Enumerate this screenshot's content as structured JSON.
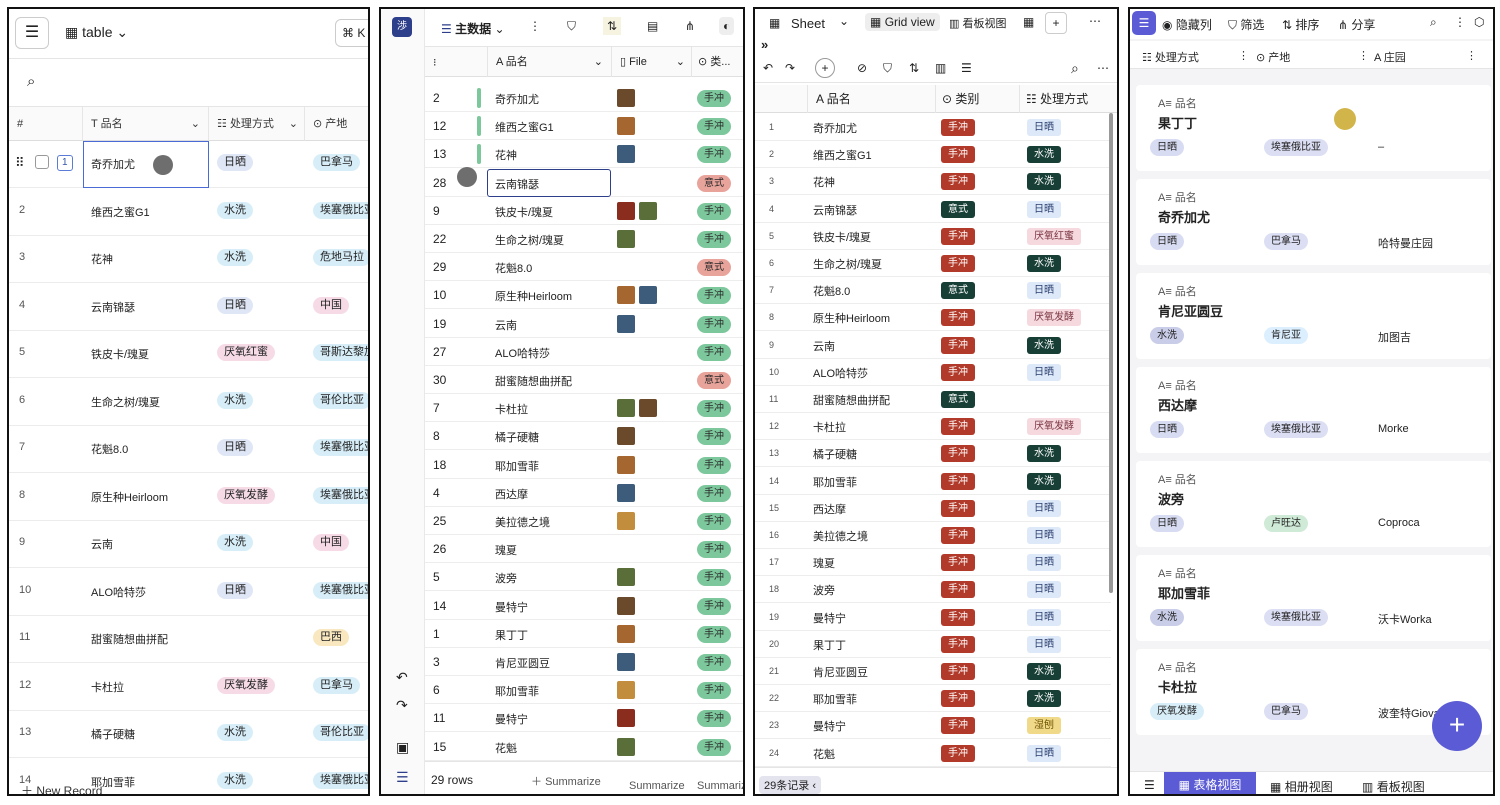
{
  "panel1": {
    "view_name": "table",
    "shortcut": "⌘ K",
    "columns": [
      "#",
      "品名",
      "处理方式",
      "产地"
    ],
    "selected_index": "1",
    "new_record": "New Record",
    "rows": [
      {
        "n": "",
        "name": "奇乔加尤",
        "proc": "日晒",
        "origin": "巴拿马"
      },
      {
        "n": "2",
        "name": "维西之蜜G1",
        "proc": "水洗",
        "origin": "埃塞俄比亚"
      },
      {
        "n": "3",
        "name": "花神",
        "proc": "水洗",
        "origin": "危地马拉"
      },
      {
        "n": "4",
        "name": "云南锦瑟",
        "proc": "日晒",
        "origin": "中国"
      },
      {
        "n": "5",
        "name": "铁皮卡/瑰夏",
        "proc": "厌氧红蜜",
        "origin": "哥斯达黎加"
      },
      {
        "n": "6",
        "name": "生命之树/瑰夏",
        "proc": "水洗",
        "origin": "哥伦比亚"
      },
      {
        "n": "7",
        "name": "花魁8.0",
        "proc": "日晒",
        "origin": "埃塞俄比亚"
      },
      {
        "n": "8",
        "name": "原生种Heirloom",
        "proc": "厌氧发酵",
        "origin": "埃塞俄比亚"
      },
      {
        "n": "9",
        "name": "云南",
        "proc": "水洗",
        "origin": "中国"
      },
      {
        "n": "10",
        "name": "ALO哈特莎",
        "proc": "日晒",
        "origin": "埃塞俄比亚"
      },
      {
        "n": "11",
        "name": "甜蜜随想曲拼配",
        "proc": "",
        "origin": "巴西"
      },
      {
        "n": "12",
        "name": "卡杜拉",
        "proc": "厌氧发酵",
        "origin": "巴拿马"
      },
      {
        "n": "13",
        "name": "橘子硬糖",
        "proc": "水洗",
        "origin": "哥伦比亚"
      },
      {
        "n": "14",
        "name": "耶加雪菲",
        "proc": "水洗",
        "origin": "埃塞俄比亚"
      }
    ]
  },
  "panel2": {
    "logo": "渉",
    "view_name": "主数据",
    "columns": [
      "品名",
      "File",
      "类..."
    ],
    "rows_count": "29 rows",
    "summarize": "Summarize",
    "rows": [
      {
        "n": "2",
        "name": "奇乔加尤",
        "type": "手冲",
        "files": 1
      },
      {
        "n": "12",
        "name": "维西之蜜G1",
        "type": "手冲",
        "files": 1
      },
      {
        "n": "13",
        "name": "花神",
        "type": "手冲",
        "files": 1
      },
      {
        "n": "28",
        "name": "云南锦瑟",
        "type": "意式",
        "files": 0
      },
      {
        "n": "9",
        "name": "铁皮卡/瑰夏",
        "type": "手冲",
        "files": 2
      },
      {
        "n": "22",
        "name": "生命之树/瑰夏",
        "type": "手冲",
        "files": 1
      },
      {
        "n": "29",
        "name": "花魁8.0",
        "type": "意式",
        "files": 0
      },
      {
        "n": "10",
        "name": "原生种Heirloom",
        "type": "手冲",
        "files": 2
      },
      {
        "n": "19",
        "name": "云南",
        "type": "手冲",
        "files": 1
      },
      {
        "n": "27",
        "name": "ALO哈特莎",
        "type": "手冲",
        "files": 0
      },
      {
        "n": "30",
        "name": "甜蜜随想曲拼配",
        "type": "意式",
        "files": 0
      },
      {
        "n": "7",
        "name": "卡杜拉",
        "type": "手冲",
        "files": 2
      },
      {
        "n": "8",
        "name": "橘子硬糖",
        "type": "手冲",
        "files": 1
      },
      {
        "n": "18",
        "name": "耶加雪菲",
        "type": "手冲",
        "files": 1
      },
      {
        "n": "4",
        "name": "西达摩",
        "type": "手冲",
        "files": 1
      },
      {
        "n": "25",
        "name": "美拉德之境",
        "type": "手冲",
        "files": 1
      },
      {
        "n": "26",
        "name": "瑰夏",
        "type": "手冲",
        "files": 0
      },
      {
        "n": "5",
        "name": "波旁",
        "type": "手冲",
        "files": 1
      },
      {
        "n": "14",
        "name": "曼特宁",
        "type": "手冲",
        "files": 1
      },
      {
        "n": "1",
        "name": "果丁丁",
        "type": "手冲",
        "files": 1
      },
      {
        "n": "3",
        "name": "肯尼亚圆豆",
        "type": "手冲",
        "files": 1
      },
      {
        "n": "6",
        "name": "耶加雪菲",
        "type": "手冲",
        "files": 1
      },
      {
        "n": "11",
        "name": "曼特宁",
        "type": "手冲",
        "files": 1
      },
      {
        "n": "15",
        "name": "花魁",
        "type": "手冲",
        "files": 1
      }
    ]
  },
  "panel3": {
    "sheet": "Sheet",
    "grid_view": "Grid view",
    "kanban": "看板视图",
    "columns": [
      "品名",
      "类别",
      "处理方式"
    ],
    "record_count": "29条记录",
    "rows": [
      {
        "n": "1",
        "name": "奇乔加尤",
        "type": "手冲",
        "proc": "日晒"
      },
      {
        "n": "2",
        "name": "维西之蜜G1",
        "type": "手冲",
        "proc": "水洗"
      },
      {
        "n": "3",
        "name": "花神",
        "type": "手冲",
        "proc": "水洗"
      },
      {
        "n": "4",
        "name": "云南锦瑟",
        "type": "意式",
        "proc": "日晒"
      },
      {
        "n": "5",
        "name": "铁皮卡/瑰夏",
        "type": "手冲",
        "proc": "厌氧红蜜"
      },
      {
        "n": "6",
        "name": "生命之树/瑰夏",
        "type": "手冲",
        "proc": "水洗"
      },
      {
        "n": "7",
        "name": "花魁8.0",
        "type": "意式",
        "proc": "日晒"
      },
      {
        "n": "8",
        "name": "原生种Heirloom",
        "type": "手冲",
        "proc": "厌氧发酵"
      },
      {
        "n": "9",
        "name": "云南",
        "type": "手冲",
        "proc": "水洗"
      },
      {
        "n": "10",
        "name": "ALO哈特莎",
        "type": "手冲",
        "proc": "日晒"
      },
      {
        "n": "11",
        "name": "甜蜜随想曲拼配",
        "type": "意式",
        "proc": ""
      },
      {
        "n": "12",
        "name": "卡杜拉",
        "type": "手冲",
        "proc": "厌氧发酵"
      },
      {
        "n": "13",
        "name": "橘子硬糖",
        "type": "手冲",
        "proc": "水洗"
      },
      {
        "n": "14",
        "name": "耶加雪菲",
        "type": "手冲",
        "proc": "水洗"
      },
      {
        "n": "15",
        "name": "西达摩",
        "type": "手冲",
        "proc": "日晒"
      },
      {
        "n": "16",
        "name": "美拉德之境",
        "type": "手冲",
        "proc": "日晒"
      },
      {
        "n": "17",
        "name": "瑰夏",
        "type": "手冲",
        "proc": "日晒"
      },
      {
        "n": "18",
        "name": "波旁",
        "type": "手冲",
        "proc": "日晒"
      },
      {
        "n": "19",
        "name": "曼特宁",
        "type": "手冲",
        "proc": "日晒"
      },
      {
        "n": "20",
        "name": "果丁丁",
        "type": "手冲",
        "proc": "日晒"
      },
      {
        "n": "21",
        "name": "肯尼亚圆豆",
        "type": "手冲",
        "proc": "水洗"
      },
      {
        "n": "22",
        "name": "耶加雪菲",
        "type": "手冲",
        "proc": "水洗"
      },
      {
        "n": "23",
        "name": "曼特宁",
        "type": "手冲",
        "proc": "湿刨"
      },
      {
        "n": "24",
        "name": "花魁",
        "type": "手冲",
        "proc": "日晒"
      }
    ]
  },
  "panel4": {
    "toolbar": [
      "隐藏列",
      "筛选",
      "排序",
      "分享"
    ],
    "columns": [
      "处理方式",
      "产地",
      "庄园"
    ],
    "field_label": "品名",
    "cards": [
      {
        "title": "果丁丁",
        "proc": "日晒",
        "origin": "埃塞俄比亚",
        "estate": "–"
      },
      {
        "title": "奇乔加尤",
        "proc": "日晒",
        "origin": "巴拿马",
        "estate": "哈特曼庄园"
      },
      {
        "title": "肯尼亚圆豆",
        "proc": "水洗",
        "origin": "肯尼亚",
        "estate": "加图吉"
      },
      {
        "title": "西达摩",
        "proc": "日晒",
        "origin": "埃塞俄比亚",
        "estate": "Morke"
      },
      {
        "title": "波旁",
        "proc": "日晒",
        "origin": "卢旺达",
        "estate": "Coproca"
      },
      {
        "title": "耶加雪菲",
        "proc": "水洗",
        "origin": "埃塞俄比亚",
        "estate": "沃卡Worka"
      },
      {
        "title": "卡杜拉",
        "proc": "厌氧发酵",
        "origin": "巴拿马",
        "estate": "波奎特Giova"
      }
    ],
    "tabs": [
      "表格视图",
      "相册视图",
      "看板视图"
    ]
  },
  "colors": {
    "p1_sun": "#dfe6f5",
    "p1_wash": "#d7eef8",
    "p1_anaer": "#f6dbe7",
    "p1_origin": "#d7eef8",
    "p2_hand": "#7cc79b",
    "p2_esp": "#e8a39a",
    "p3_hand": "#b23a2a",
    "p3_esp": "#173f36",
    "p3_wash": "#173f36",
    "p3_sun": "#dde8f8",
    "p3_anaer": "#f5d9de",
    "p4_accent": "#5b5bd6"
  }
}
